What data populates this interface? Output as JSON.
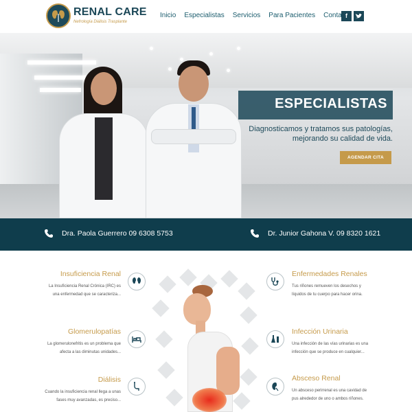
{
  "header": {
    "logo_title": "RENAL CARE",
    "logo_subtitle": "Nefrología Diálisis Trasplante",
    "nav": [
      "Inicio",
      "Especialistas",
      "Servicios",
      "Para Pacientes",
      "Contacto"
    ],
    "social": {
      "facebook": "f",
      "twitter": "t"
    }
  },
  "hero": {
    "title": "ESPECIALISTAS",
    "text_line1": "Diagnosticamos y tratamos sus patologías,",
    "text_line2": "mejorando su calidad de vida.",
    "button": "AGENDAR CITA"
  },
  "contacts": [
    {
      "label": "Dra. Paola Guerrero 09 6308 5753"
    },
    {
      "label": "Dr. Junior Gahona V. 09 8320 1621"
    }
  ],
  "services": {
    "left": [
      {
        "title": "Insuficiencia Renal",
        "line1": "La Insuficiencia Renal Crónica (IRC) es",
        "line2": "una enfermedad que se caracteriza...",
        "icon": "kidneys-icon"
      },
      {
        "title": "Glomerulopatías",
        "line1": "La glomerulonefritis es un problema que",
        "line2": "afecta a las diminutas unidades...",
        "icon": "hospital-bed-icon"
      },
      {
        "title": "Diálisis",
        "line1": "Cuando la insuficiencia renal llega a unas",
        "line2": "fases muy avanzadas, es preciso...",
        "icon": "dialysis-icon"
      }
    ],
    "right": [
      {
        "title": "Enfermedades Renales",
        "line1": "Tus riñones remueven los desechos y",
        "line2": "líquidos de tu cuerpo para hacer orina.",
        "icon": "stethoscope-icon"
      },
      {
        "title": "Infección Urinaria",
        "line1": "Una infección de las vías urinarias es una",
        "line2": "infección que se produce en cualquier...",
        "icon": "lab-flasks-icon"
      },
      {
        "title": "Absceso Renal",
        "line1": "Un absceso perirrenal es una cavidad de",
        "line2": "pus alrededor de uno o ambos riñones.",
        "icon": "kidney-icon"
      }
    ]
  },
  "colors": {
    "primary": "#0f3d4c",
    "accent": "#c59a4a",
    "nav": "#1b5c6d"
  }
}
